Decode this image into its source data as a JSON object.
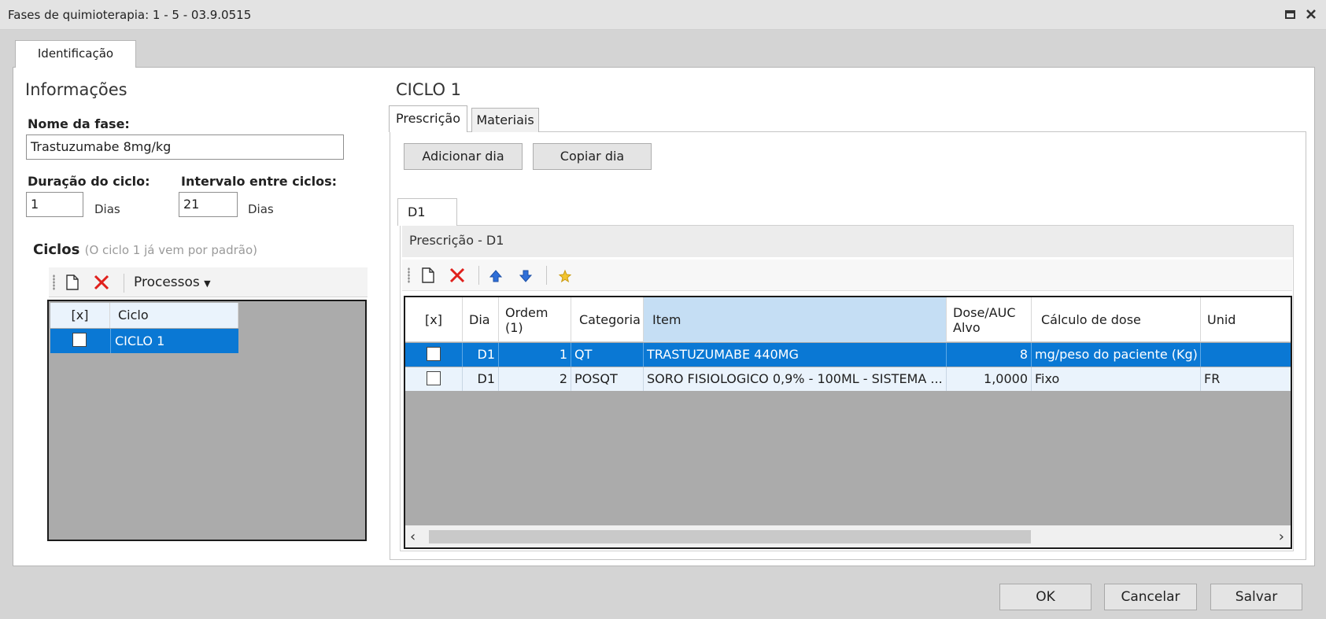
{
  "window": {
    "title": "Fases de quimioterapia: 1 - 5 - 03.9.0515"
  },
  "tabs": {
    "identificacao": "Identificação"
  },
  "info": {
    "title": "Informações",
    "nome_label": "Nome da fase:",
    "nome_value": "Trastuzumabe 8mg/kg",
    "duracao_label": "Duração do ciclo:",
    "duracao_value": "1",
    "duracao_unit": "Dias",
    "intervalo_label": "Intervalo entre ciclos:",
    "intervalo_value": "21",
    "intervalo_unit": "Dias"
  },
  "ciclos": {
    "title": "Ciclos",
    "hint": "(O ciclo 1 já vem por padrão)",
    "toolbar": {
      "processos": "Processos"
    },
    "columns": [
      "[x]",
      "Ciclo"
    ],
    "rows": [
      {
        "checked": false,
        "ciclo": "CICLO 1"
      }
    ]
  },
  "ciclo_panel": {
    "title": "CICLO 1",
    "tabs": [
      "Prescrição",
      "Materiais"
    ],
    "buttons": {
      "adicionar": "Adicionar dia",
      "copiar": "Copiar dia"
    },
    "day_tab": "D1",
    "prescricao_header": "Prescrição - D1",
    "grid": {
      "columns": [
        "[x]",
        "Dia",
        "Ordem\n(1)",
        "Categoria",
        "Item",
        "Dose/AUC\nAlvo",
        "Cálculo de dose",
        "Unid"
      ],
      "rows": [
        {
          "checked": false,
          "dia": "D1",
          "ordem": "1",
          "categoria": "QT",
          "item": "TRASTUZUMABE 440MG",
          "dose": "8",
          "calculo": "mg/peso do paciente (Kg)",
          "unid": ""
        },
        {
          "checked": false,
          "dia": "D1",
          "ordem": "2",
          "categoria": "POSQT",
          "item": "SORO FISIOLOGICO 0,9% - 100ML - SISTEMA ...",
          "dose": "1,0000",
          "calculo": "Fixo",
          "unid": "FR"
        }
      ]
    }
  },
  "footer": {
    "ok": "OK",
    "cancelar": "Cancelar",
    "salvar": "Salvar"
  },
  "colors": {
    "selection": "#0a78d4",
    "grid_bg": "#ababab",
    "header_sel": "#c5def4",
    "delete_red": "#e0201c"
  }
}
